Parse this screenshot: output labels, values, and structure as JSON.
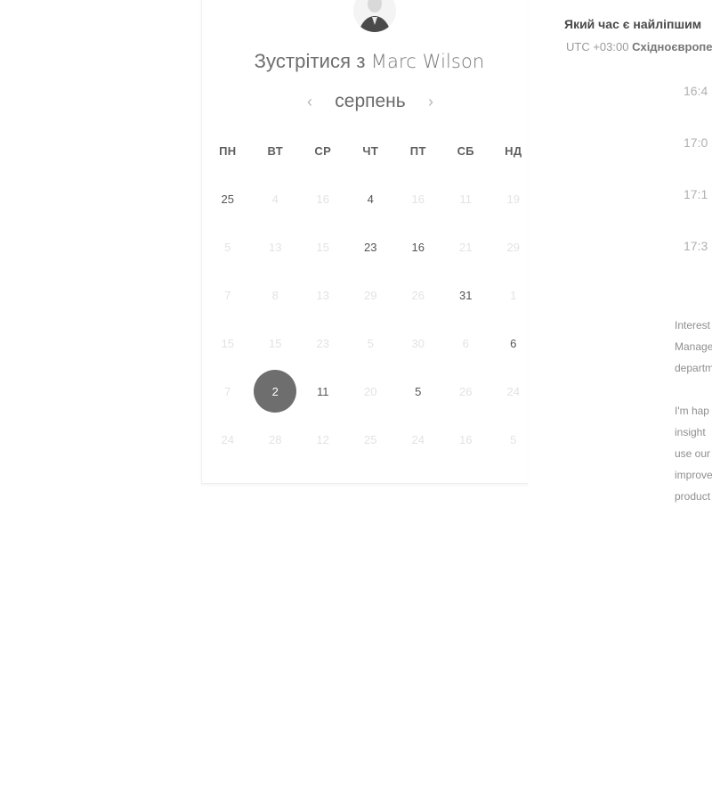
{
  "meeting": {
    "prefix": "Зустрітися з ",
    "name": "Marc Wilson"
  },
  "calendar": {
    "month": "серпень",
    "prev_icon": "chevron-left-icon",
    "next_icon": "chevron-right-icon",
    "weekdays": [
      "ПН",
      "ВТ",
      "СР",
      "ЧТ",
      "ПТ",
      "СБ",
      "НД"
    ],
    "weeks": [
      [
        {
          "d": "25",
          "a": true
        },
        {
          "d": "4",
          "a": false
        },
        {
          "d": "16",
          "a": false
        },
        {
          "d": "4",
          "a": true
        },
        {
          "d": "16",
          "a": false
        },
        {
          "d": "11",
          "a": false
        },
        {
          "d": "19",
          "a": false
        }
      ],
      [
        {
          "d": "5",
          "a": false
        },
        {
          "d": "13",
          "a": false
        },
        {
          "d": "15",
          "a": false
        },
        {
          "d": "23",
          "a": true
        },
        {
          "d": "16",
          "a": true
        },
        {
          "d": "21",
          "a": false
        },
        {
          "d": "29",
          "a": false
        }
      ],
      [
        {
          "d": "7",
          "a": false
        },
        {
          "d": "8",
          "a": false
        },
        {
          "d": "13",
          "a": false
        },
        {
          "d": "29",
          "a": false
        },
        {
          "d": "26",
          "a": false
        },
        {
          "d": "31",
          "a": true
        },
        {
          "d": "1",
          "a": false
        }
      ],
      [
        {
          "d": "15",
          "a": false
        },
        {
          "d": "15",
          "a": false
        },
        {
          "d": "23",
          "a": false
        },
        {
          "d": "5",
          "a": false
        },
        {
          "d": "30",
          "a": false
        },
        {
          "d": "6",
          "a": false
        },
        {
          "d": "6",
          "a": true
        }
      ],
      [
        {
          "d": "7",
          "a": false
        },
        {
          "d": "2",
          "a": true,
          "s": true
        },
        {
          "d": "11",
          "a": true
        },
        {
          "d": "20",
          "a": false
        },
        {
          "d": "5",
          "a": true
        },
        {
          "d": "26",
          "a": false
        },
        {
          "d": "24",
          "a": false
        }
      ],
      [
        {
          "d": "24",
          "a": false
        },
        {
          "d": "28",
          "a": false
        },
        {
          "d": "12",
          "a": false
        },
        {
          "d": "25",
          "a": false
        },
        {
          "d": "24",
          "a": false
        },
        {
          "d": "16",
          "a": false
        },
        {
          "d": "5",
          "a": false
        }
      ]
    ]
  },
  "times": {
    "title": "Який час є найліпшим",
    "tz_prefix": "UTC +03:00 ",
    "tz_name": "Східноєвропе",
    "slots": [
      "16:4",
      "17:0",
      "17:1",
      "17:3"
    ]
  },
  "description": {
    "lines_1": [
      "Interest",
      "Manage",
      "departm"
    ],
    "lines_2": [
      "I'm hap",
      "insight",
      "use our",
      "improve",
      "product"
    ]
  }
}
